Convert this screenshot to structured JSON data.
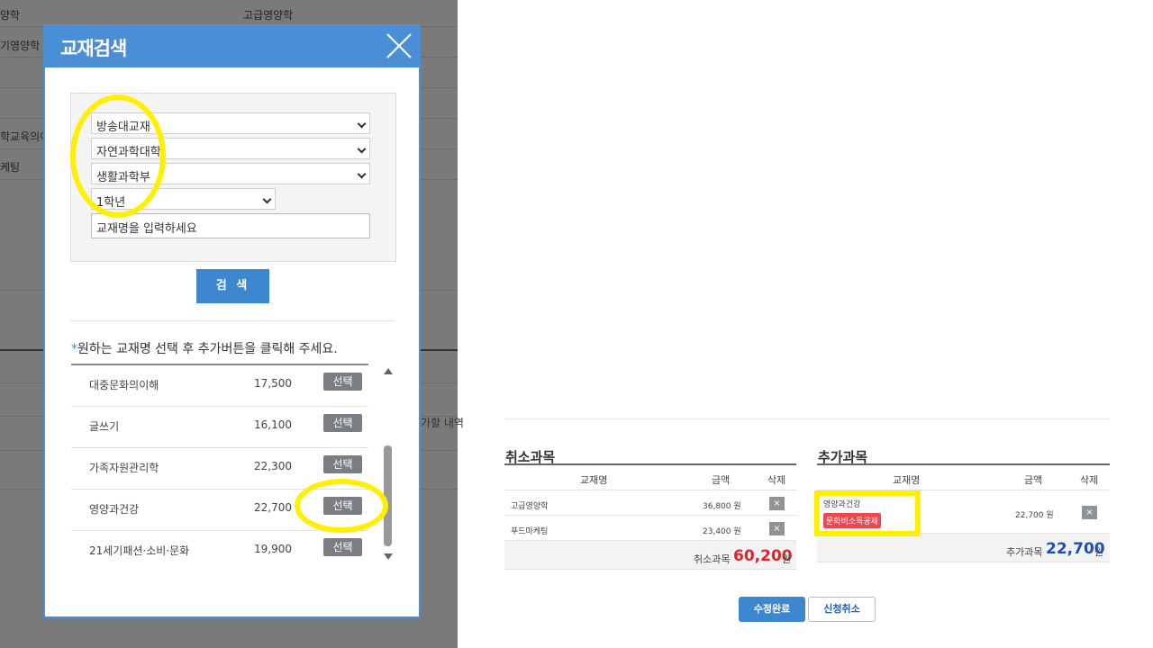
{
  "background": {
    "header_col1": "양학",
    "header_col2": "고급영양학",
    "row1": "기영양학",
    "row2": "학교육의이",
    "row3": "케팅",
    "side_note": "가할 내역"
  },
  "modal": {
    "title": "교재검색",
    "filters": {
      "material_type": "방송대교재",
      "college": "자연과학대학",
      "department": "생활과학부",
      "grade": "1학년"
    },
    "book_name_placeholder": "교재명을 입력하세요",
    "search_label": "검 색",
    "instruction_star": "*",
    "instruction": "원하는 교재명 선택 후 추가버튼을 클릭해 주세요.",
    "select_label": "선택",
    "books": [
      {
        "name": "대중문화의이해",
        "price": "17,500"
      },
      {
        "name": "글쓰기",
        "price": "16,100"
      },
      {
        "name": "가족자원관리학",
        "price": "22,300"
      },
      {
        "name": "영양과건강",
        "price": "22,700"
      },
      {
        "name": "21세기패션·소비·문화",
        "price": "19,900"
      }
    ]
  },
  "cancel_panel": {
    "title": "취소과목",
    "col_name": "교재명",
    "col_price": "금액",
    "col_delete": "삭제",
    "rows": [
      {
        "name": "고급영양학",
        "price": "36,800 원"
      },
      {
        "name": "푸드마케팅",
        "price": "23,400 원"
      }
    ],
    "total_label": "취소과목",
    "total_amount": "60,200",
    "total_unit": "원"
  },
  "add_panel": {
    "title": "추가과목",
    "col_name": "교재명",
    "col_price": "금액",
    "col_delete": "삭제",
    "rows": [
      {
        "name": "영양과건강",
        "badge": "문화비소득공제",
        "price": "22,700 원"
      }
    ],
    "total_label": "추가과목",
    "total_amount": "22,700",
    "total_unit": "원"
  },
  "actions": {
    "done": "수정완료",
    "cancel": "신청취소"
  },
  "delete_glyph": "×",
  "colors": {
    "accent": "#4a8fd6",
    "button_blue": "#3d87d0",
    "cancel_total": "#e0242b",
    "add_total": "#1f4fb3",
    "badge": "#e9494f",
    "highlight": "#ffef00"
  }
}
